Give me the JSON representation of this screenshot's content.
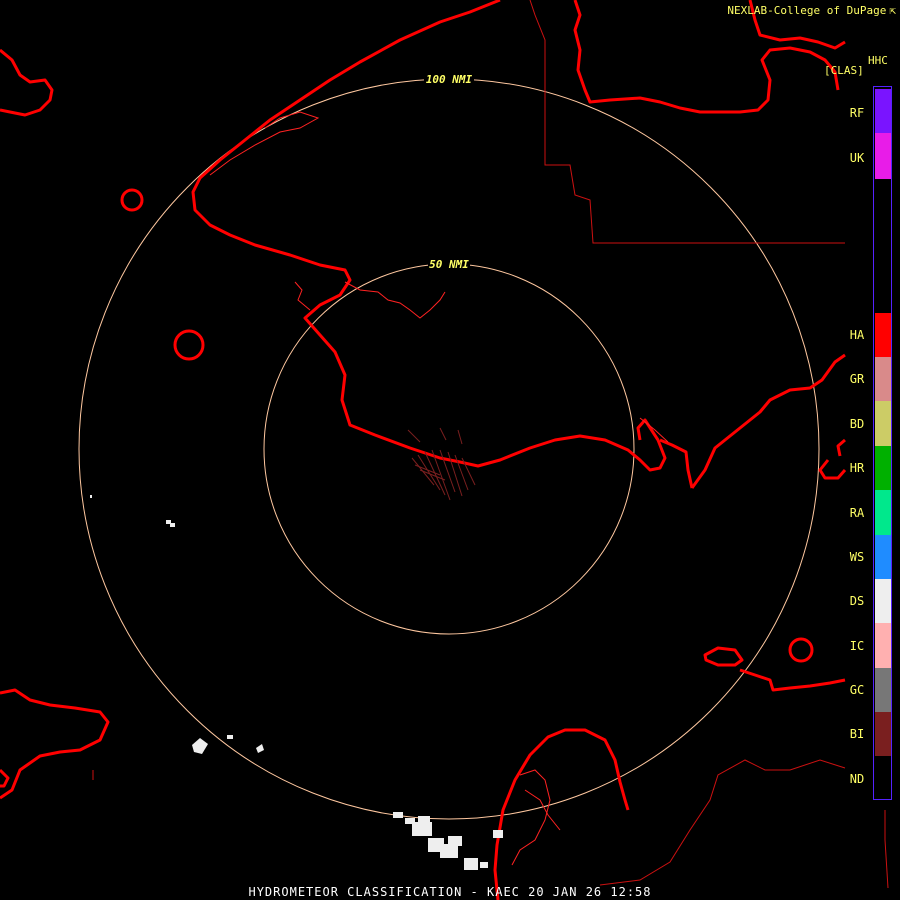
{
  "header": {
    "credit": "NEXLAB-College of DuPage",
    "product_code": "HHC",
    "class_label": "[CLAS]"
  },
  "rings": [
    {
      "label": "100 NMI"
    },
    {
      "label": "50 NMI"
    }
  ],
  "legend": [
    {
      "code": "RF",
      "color": "#7a14ff"
    },
    {
      "code": "UK",
      "color": "#e81ce8"
    },
    {
      "code": "HA",
      "color": "#ff0000"
    },
    {
      "code": "GR",
      "color": "#d98a8a"
    },
    {
      "code": "BD",
      "color": "#cccc66"
    },
    {
      "code": "HR",
      "color": "#00b000"
    },
    {
      "code": "RA",
      "color": "#00e88c"
    },
    {
      "code": "WS",
      "color": "#1f8cff"
    },
    {
      "code": "DS",
      "color": "#eeeeee"
    },
    {
      "code": "IC",
      "color": "#ffb0b0"
    },
    {
      "code": "GC",
      "color": "#777777"
    },
    {
      "code": "BI",
      "color": "#7a1f1f"
    },
    {
      "code": "ND",
      "color": "#000000"
    }
  ],
  "footer": {
    "title": "HYDROMETEOR CLASSIFICATION - KAEC 20 JAN 26 12:58"
  },
  "map_colors": {
    "coastline": "#ff0000",
    "border": "#cc1111",
    "range_ring": "#ffc8a0",
    "snow_echo": "#eeeeee"
  }
}
